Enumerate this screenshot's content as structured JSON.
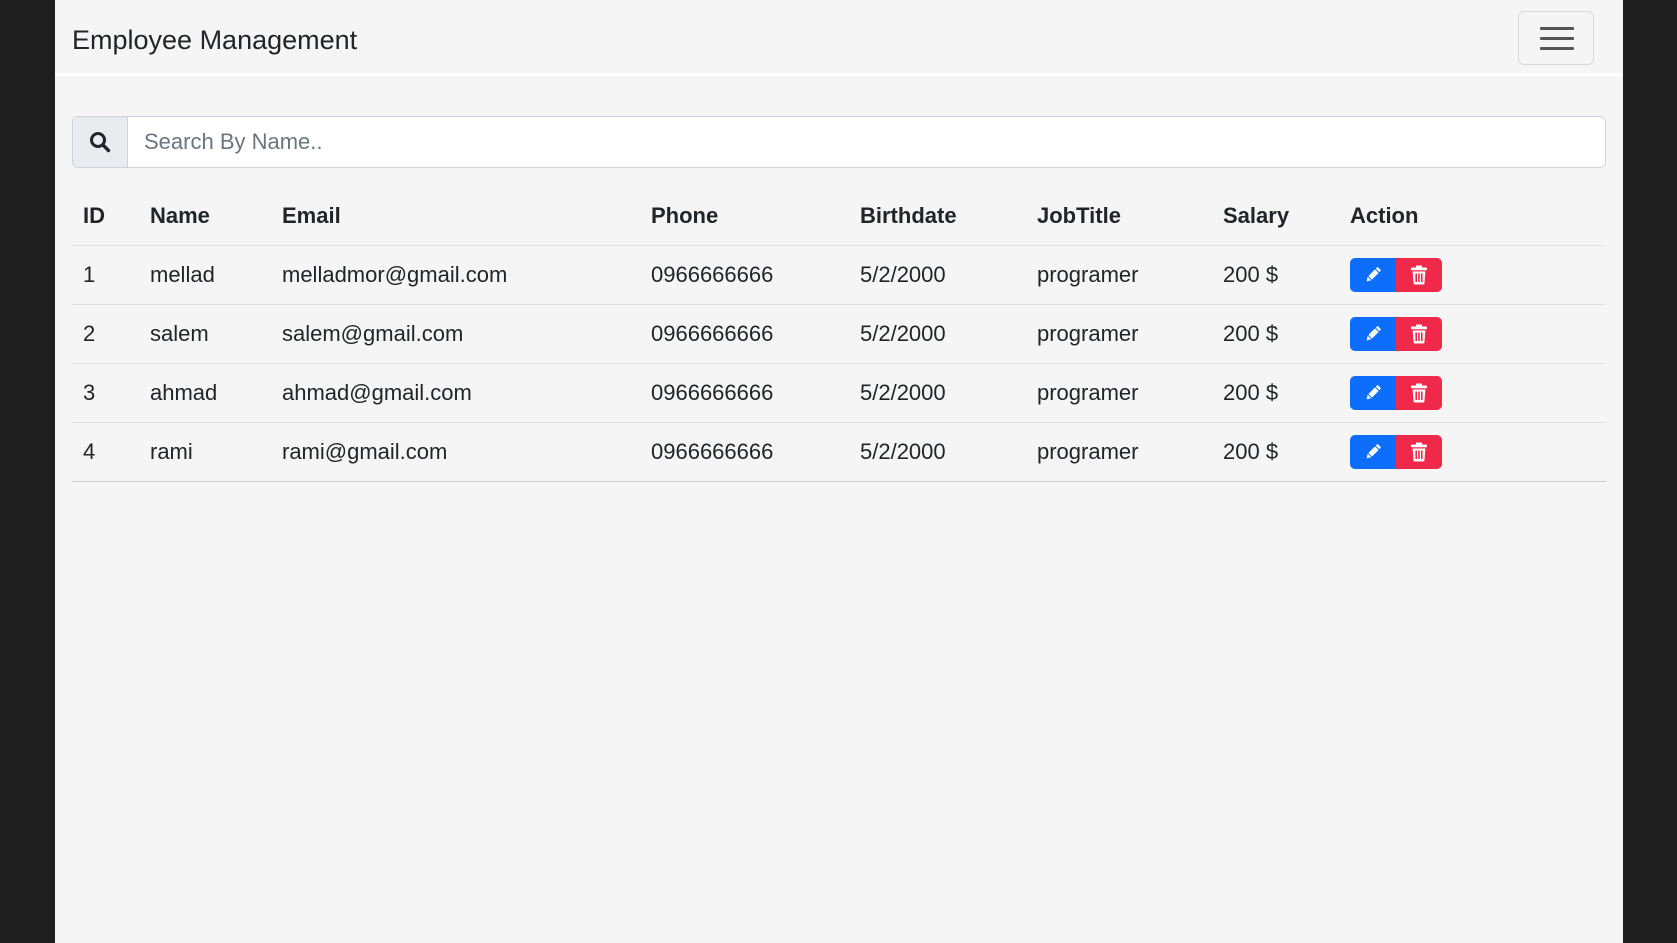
{
  "navbar": {
    "brand": "Employee Management"
  },
  "search": {
    "placeholder": "Search By Name.."
  },
  "table": {
    "headers": [
      "ID",
      "Name",
      "Email",
      "Phone",
      "Birthdate",
      "JobTitle",
      "Salary",
      "Action"
    ],
    "rows": [
      {
        "id": "1",
        "name": "mellad",
        "email": "melladmor@gmail.com",
        "phone": "0966666666",
        "birthdate": "5/2/2000",
        "job": "programer",
        "salary": "200 $"
      },
      {
        "id": "2",
        "name": "salem",
        "email": "salem@gmail.com",
        "phone": "0966666666",
        "birthdate": "5/2/2000",
        "job": "programer",
        "salary": "200 $"
      },
      {
        "id": "3",
        "name": "ahmad",
        "email": "ahmad@gmail.com",
        "phone": "0966666666",
        "birthdate": "5/2/2000",
        "job": "programer",
        "salary": "200 $"
      },
      {
        "id": "4",
        "name": "rami",
        "email": "rami@gmail.com",
        "phone": "0966666666",
        "birthdate": "5/2/2000",
        "job": "programer",
        "salary": "200 $"
      }
    ]
  },
  "colors": {
    "edit_button": "#0d6efd",
    "delete_button": "#f0284a",
    "page_background": "#f5f5f5",
    "frame_background": "#1e1e1e"
  },
  "icons": {
    "menu": "hamburger-icon",
    "search": "search-icon",
    "edit": "pencil-icon",
    "delete": "trash-icon"
  }
}
